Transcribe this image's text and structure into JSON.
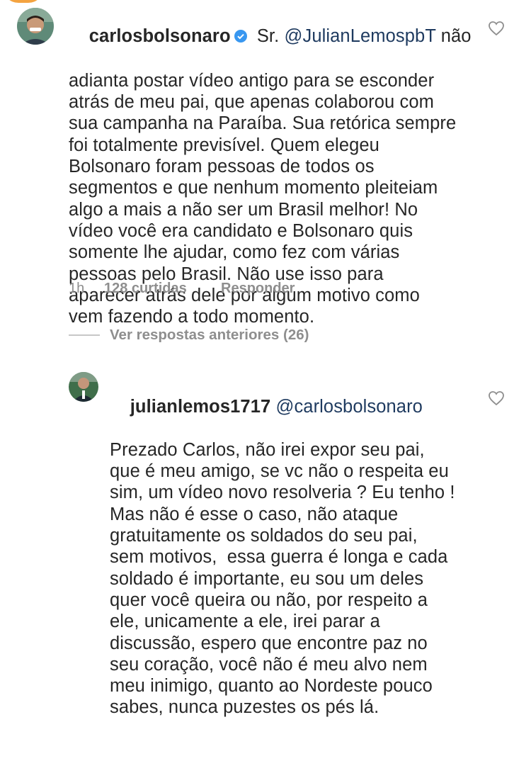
{
  "comments": [
    {
      "username": "carlosbolsonaro",
      "verified": true,
      "mention": "@JulianLemospbT",
      "text_first_line_rest": " não",
      "body": "adianta postar vídeo antigo para se esconder\natrás de meu pai, que apenas colaborou com\nsua campanha na Paraíba. Sua retórica sempre\nfoi totalmente previsível. Quem elegeu\nBolsonaro foram pessoas de todos os\nsegmentos e que nenhum momento pleiteiam\nalgo a mais a não ser um Brasil melhor! No\nvídeo você era candidato e Bolsonaro quis\nsomente lhe ajudar, como fez com várias\npessoas pelo Brasil. Não use isso para\naparecer atrás dele por algum motivo como\nvem fazendo a todo momento.",
      "prefix": " Sr. ",
      "time": "1h",
      "likes": "128 curtidas",
      "reply_label": "Responder"
    },
    {
      "username": "julianlemos1717",
      "mention": "@carlosbolsonaro",
      "body": "Prezado Carlos, não irei expor seu pai,\nque é meu amigo, se vc não o respeita eu\nsim, um vídeo novo resolveria ? Eu tenho !\nMas não é esse o caso, não ataque\ngratuitamente os soldados do seu pai,\nsem motivos,  essa guerra é longa e cada\nsoldado é importante, eu sou um deles\nquer você queira ou não, por respeito a\nele, unicamente a ele, irei parar a\ndiscussão, espero que encontre paz no\nseu coração, você não é meu alvo nem\nmeu inimigo, quanto ao Nordeste pouco\nsabes, nunca puzestes os pés lá."
    }
  ],
  "view_replies": "Ver respostas anteriores (26)",
  "icons": {
    "heart": "heart-outline-icon",
    "verified": "verified-badge-icon"
  },
  "colors": {
    "text": "#262626",
    "muted": "#8e8e8e",
    "verified_blue": "#3897f0",
    "story_ring": "#f4a340"
  }
}
